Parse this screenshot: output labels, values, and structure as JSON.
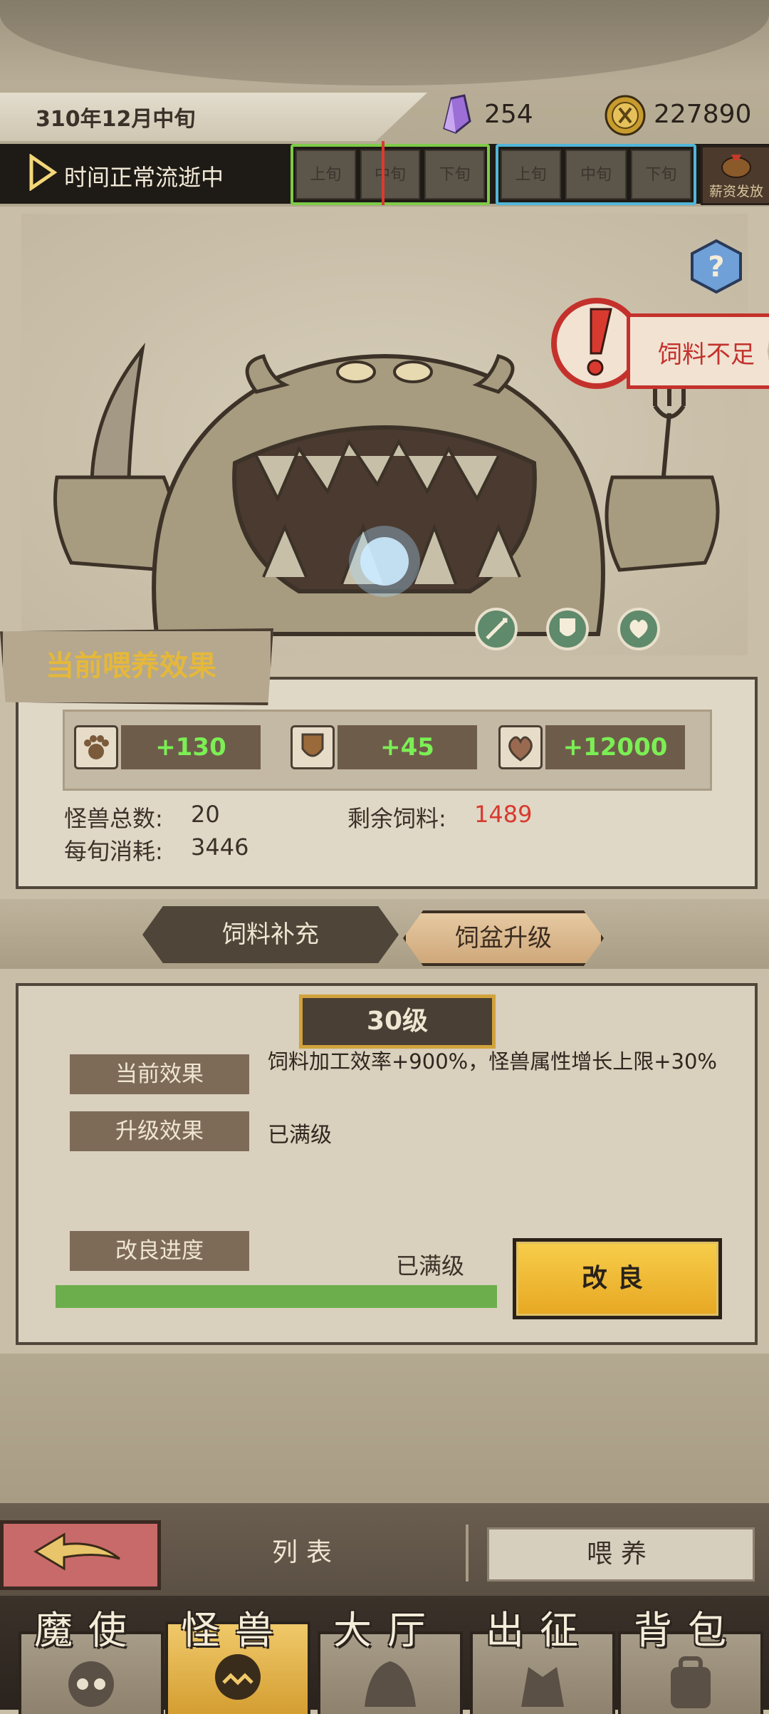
{
  "header": {
    "date": "310年12月中旬",
    "gems": "254",
    "coins": "227890",
    "time_status": "时间正常流逝中",
    "segments_group1": [
      "上旬",
      "中旬",
      "下旬"
    ],
    "segments_group2": [
      "上旬",
      "中旬",
      "下旬"
    ],
    "salary_label": "薪资发放"
  },
  "scene": {
    "warning": "饲料不足"
  },
  "feeding": {
    "title": "当前喂养效果",
    "bonuses": [
      "+130",
      "+45",
      "+12000"
    ],
    "total_label": "怪兽总数:",
    "total_value": "20",
    "remain_label": "剩余饲料:",
    "remain_value": "1489",
    "consume_label": "每旬消耗:",
    "consume_value": "3446"
  },
  "tabs": {
    "supply": "饲料补充",
    "upgrade": "饲盆升级"
  },
  "upgrade": {
    "level": "30级",
    "current_label": "当前效果",
    "current_text": "饲料加工效率+900%，怪兽属性增长上限+30%",
    "next_label": "升级效果",
    "next_text": "已满级",
    "progress_label": "改良进度",
    "progress_text": "已满级",
    "progress_fraction": 1.0,
    "improve_button": "改良"
  },
  "bottom": {
    "list_label": "列表",
    "feed_label": "喂养"
  },
  "dock": {
    "items": [
      "魔使",
      "怪兽",
      "大厅",
      "出征",
      "背包"
    ],
    "active_index": 1
  },
  "colors": {
    "positive": "#7bef54",
    "warning": "#c4312c",
    "accent": "#e5b83a",
    "progress": "#6cae4c"
  }
}
